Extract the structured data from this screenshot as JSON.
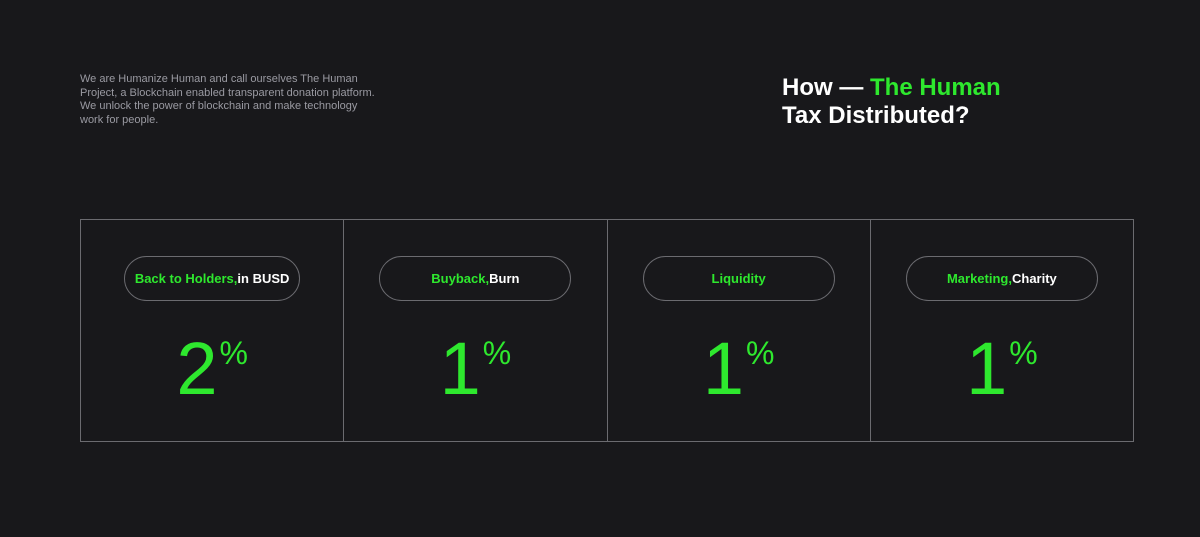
{
  "intro": {
    "text": "We are Humanize Human and call ourselves The Human Project, a Blockchain enabled transparent donation platform. We unlock the power of blockchain and make technology work for people."
  },
  "headline": {
    "prefix": "How — ",
    "accent": "The Human",
    "line2": "Tax Distributed?"
  },
  "colors": {
    "background": "#18181b",
    "accent": "#2ee82e",
    "border": "#6b6b70",
    "muted_text": "#9a9aa2"
  },
  "taxes": [
    {
      "label_accent": "Back to Holders",
      "separator": ", ",
      "label_rest": "in BUSD",
      "value": "2",
      "unit": "%"
    },
    {
      "label_accent": "Buyback",
      "separator": ", ",
      "label_rest": "Burn",
      "value": "1",
      "unit": "%"
    },
    {
      "label_accent": "Liquidity",
      "separator": "",
      "label_rest": "",
      "value": "1",
      "unit": "%"
    },
    {
      "label_accent": "Marketing",
      "separator": ", ",
      "label_rest": "Charity",
      "value": "1",
      "unit": "%"
    }
  ]
}
